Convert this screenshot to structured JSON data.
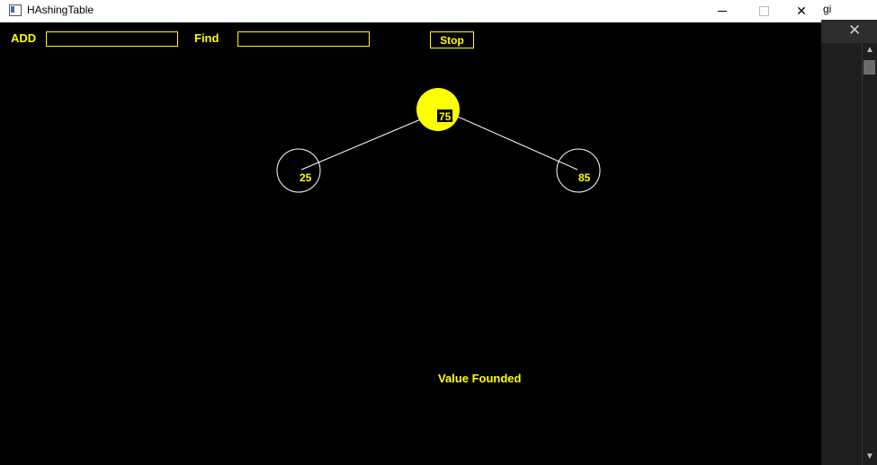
{
  "window": {
    "title": "HAshingTable"
  },
  "background_window": {
    "tab_text": "gi"
  },
  "toolbar": {
    "add_label": "ADD",
    "add_value": "",
    "find_label": "Find",
    "find_value": "",
    "stop_label": "Stop"
  },
  "tree": {
    "nodes": [
      {
        "value": "75",
        "role": "root",
        "highlighted": true
      },
      {
        "value": "25",
        "role": "left-child",
        "highlighted": false
      },
      {
        "value": "85",
        "role": "right-child",
        "highlighted": false
      }
    ]
  },
  "status": {
    "text": "Value Founded"
  },
  "colors": {
    "accent": "#ffff00",
    "background": "#000000",
    "edge": "#ffffff"
  }
}
